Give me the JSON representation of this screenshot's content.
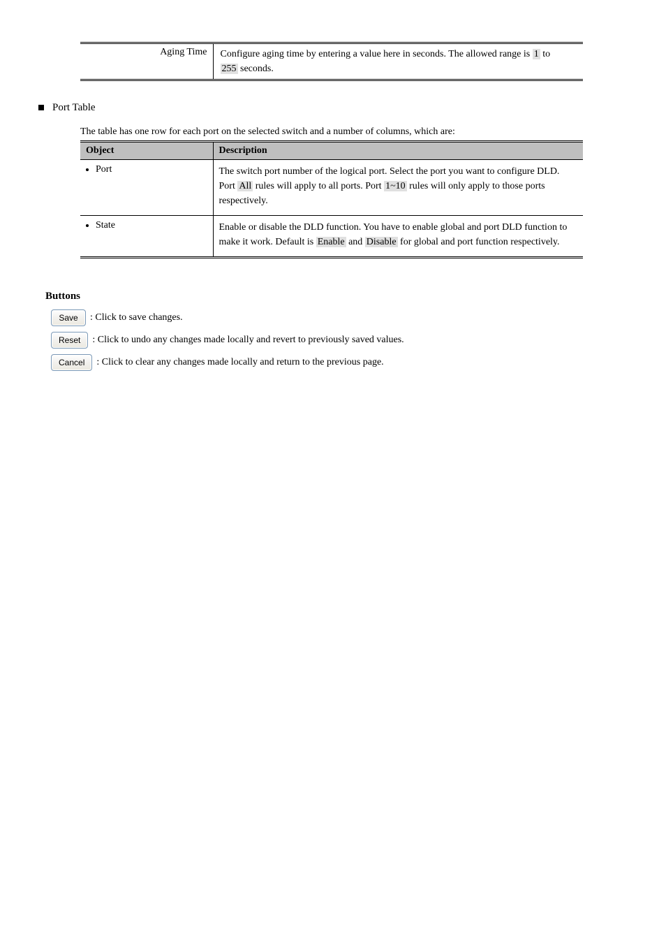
{
  "top_table": {
    "left_text": "Aging Time",
    "right_line1_before": "Configure aging time by entering a value here in seconds. The allowed range is ",
    "right_line1_hl": "1",
    "right_line1_after": " to ",
    "right_line2_hl": "255",
    "right_line2_after": " seconds."
  },
  "section_heading": "Port Table",
  "table2_caption": "The table has one row for each port on the selected switch and a number of columns, which are:",
  "table2": {
    "headers": {
      "object": "Object",
      "description": "Description"
    },
    "rows": [
      {
        "object": "Port",
        "desc_before": "The switch port number of the logical port. Select the port you want to configure DLD. Port ",
        "desc_hl1": "All",
        "desc_mid": " rules will apply to all ports. Port ",
        "desc_hl2": "1~10",
        "desc_after": " rules will only apply to those ports respectively."
      },
      {
        "object": "State",
        "desc_before": "Enable or disable the DLD function. You have to enable global and port DLD function to make it work. Default is ",
        "desc_hl1": "Enable",
        "desc_mid": " and ",
        "desc_hl2": "Disable",
        "desc_after": " for global and port function respectively."
      }
    ]
  },
  "buttons_heading": "Buttons",
  "buttons": [
    {
      "label": "Save",
      "desc": ": Click to save changes."
    },
    {
      "label": "Reset",
      "desc": ": Click to undo any changes made locally and revert to previously saved values."
    },
    {
      "label": "Cancel",
      "desc": ": Click to clear any changes made locally and return to the previous page."
    }
  ]
}
